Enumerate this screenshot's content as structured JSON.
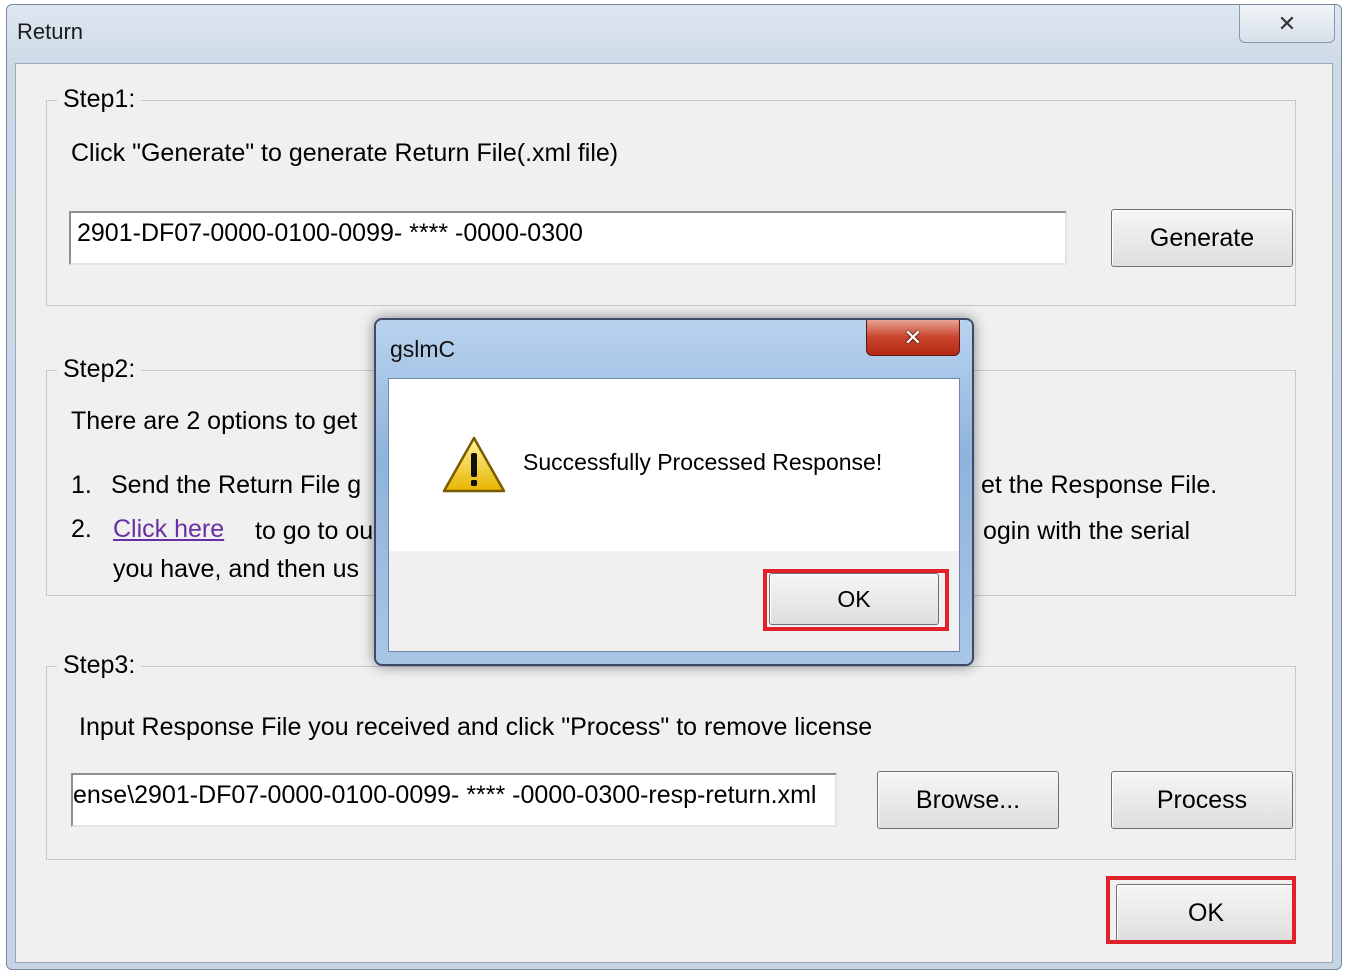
{
  "window": {
    "title": "Return",
    "close_glyph": "✕"
  },
  "step1": {
    "legend": "Step1:",
    "instruction": "Click \"Generate\" to generate Return File(.xml file)",
    "file_value": "2901-DF07-0000-0100-0099- **** -0000-0300",
    "generate_label": "Generate"
  },
  "step2": {
    "legend": "Step2:",
    "intro": "There are 2 options to get",
    "item1_num": "1.",
    "item1_text": "Send the Return File g",
    "item1_tail": "et the Response File.",
    "item2_num": "2.",
    "item2_link": "Click here",
    "item2_text": "to go to ou",
    "item2_tail": "ogin with the serial",
    "item2_line2": "you have, and then us"
  },
  "step3": {
    "legend": "Step3:",
    "instruction": "Input Response File you received and click \"Process\" to remove license",
    "file_value": "ense\\2901-DF07-0000-0100-0099- **** -0000-0300-resp-return.xml",
    "browse_label": "Browse...",
    "process_label": "Process"
  },
  "ok_label": "OK",
  "dialog": {
    "title": "gslmC",
    "close_glyph": "✕",
    "message": "Successfully Processed Response!",
    "ok_label": "OK",
    "icon": "warning-icon"
  },
  "colors": {
    "highlight": "#e0212b",
    "link": "#6b2fa5"
  }
}
